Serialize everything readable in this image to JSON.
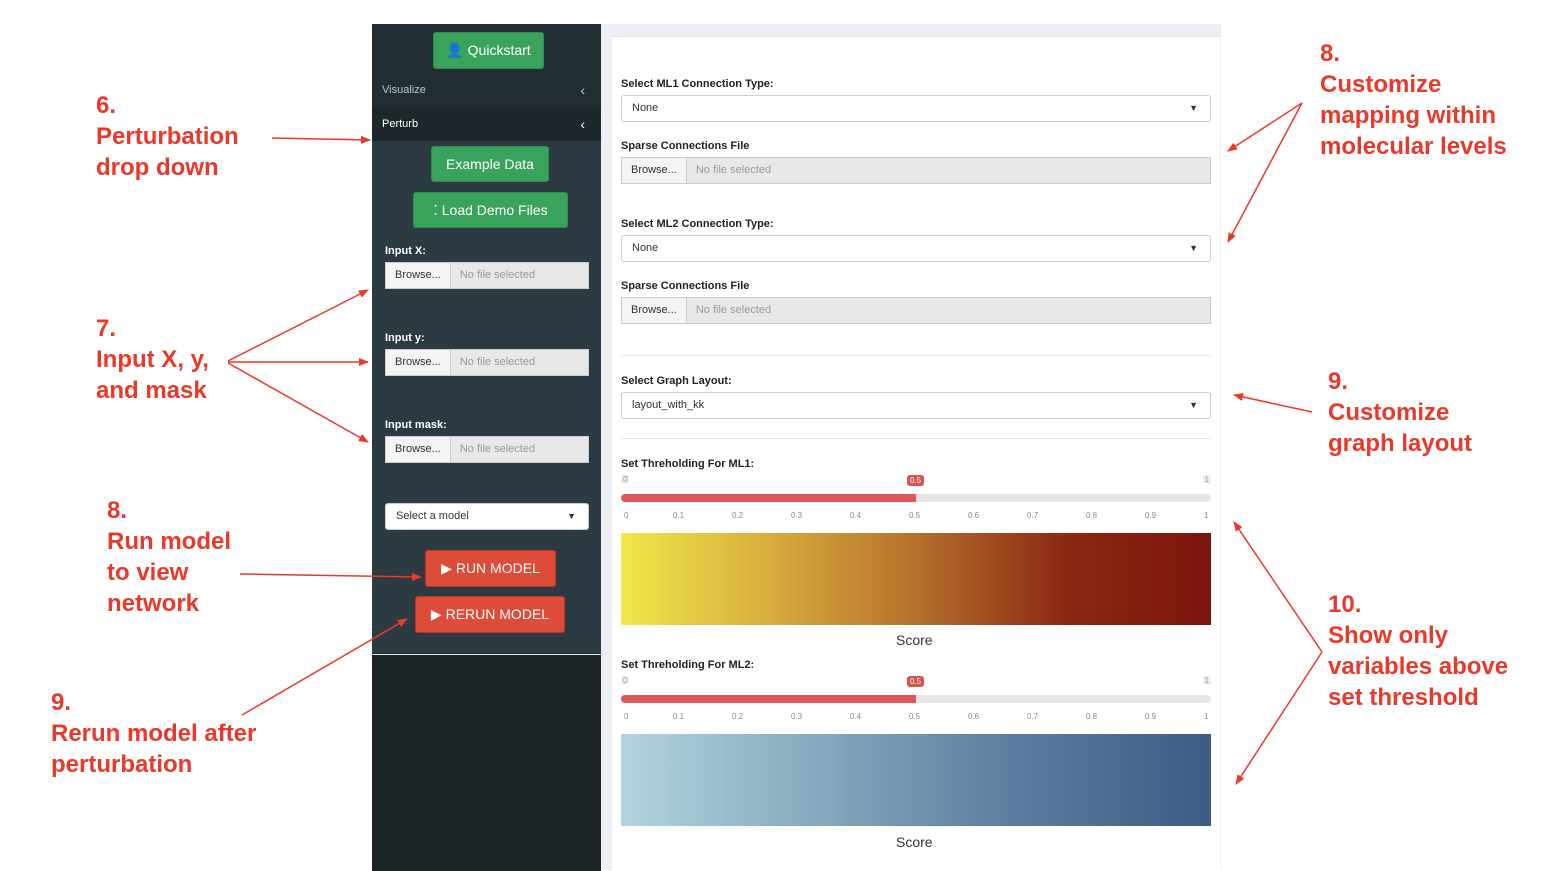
{
  "sidebar": {
    "quickstart_label": "Quickstart",
    "menu": [
      {
        "label": "Visualize"
      },
      {
        "label": "Perturb"
      }
    ],
    "example_data_label": "Example Data",
    "load_demo_label": "Load Demo Files",
    "inputs": [
      {
        "label": "Input X:",
        "browse": "Browse...",
        "file": "No file selected"
      },
      {
        "label": "Input y:",
        "browse": "Browse...",
        "file": "No file selected"
      },
      {
        "label": "Input mask:",
        "browse": "Browse...",
        "file": "No file selected"
      }
    ],
    "model_select": "Select a model",
    "run_label": "RUN MODEL",
    "rerun_label": "RERUN MODEL"
  },
  "main": {
    "ml1_conn_label": "Select ML1 Connection Type:",
    "ml1_conn_value": "None",
    "sparse1_label": "Sparse Connections File",
    "ml2_conn_label": "Select ML2 Connection Type:",
    "ml2_conn_value": "None",
    "sparse2_label": "Sparse Connections File",
    "browse": "Browse...",
    "no_file": "No file selected",
    "graph_layout_label": "Select Graph Layout:",
    "graph_layout_value": "layout_with_kk",
    "thresholds": [
      {
        "label": "Set Threholding For ML1:",
        "min": "0",
        "max": "1",
        "value": "0.5",
        "fraction": 0.5,
        "colorbar_label": "Score",
        "colors": [
          "#efe94a",
          "#d8ad3e",
          "#b4702c",
          "#8a2a13",
          "#7a150d"
        ]
      },
      {
        "label": "Set Threholding For ML2:",
        "min": "0",
        "max": "1",
        "value": "0.5",
        "fraction": 0.5,
        "colorbar_label": "Score",
        "colors": [
          "#b3d3df",
          "#86a9bd",
          "#5b7d9f",
          "#3d5b84"
        ]
      }
    ],
    "ticks": [
      "0",
      "0.1",
      "0.2",
      "0.3",
      "0.4",
      "0.5",
      "0.6",
      "0.7",
      "0.8",
      "0.9",
      "1"
    ]
  },
  "annotations": {
    "a6": [
      "6.",
      "Perturbation",
      "drop down"
    ],
    "a7": [
      "7.",
      "Input X, y,",
      "and mask"
    ],
    "a8_run": [
      "8.",
      "Run model",
      "to view",
      "network"
    ],
    "a9_rerun": [
      "9.",
      "Rerun model after",
      "perturbation"
    ],
    "a8_map": [
      "8.",
      "Customize",
      "mapping within",
      "molecular levels"
    ],
    "a9_layout": [
      "9.",
      "Customize",
      "graph layout"
    ],
    "a10": [
      "10.",
      "Show only",
      "variables above",
      "set threshold"
    ]
  },
  "colors": {
    "sidebar": "#222d32",
    "green": "#3aa35b",
    "red": "#dd4b39",
    "annotation": "#e8392b",
    "slider": "#e0575b"
  }
}
